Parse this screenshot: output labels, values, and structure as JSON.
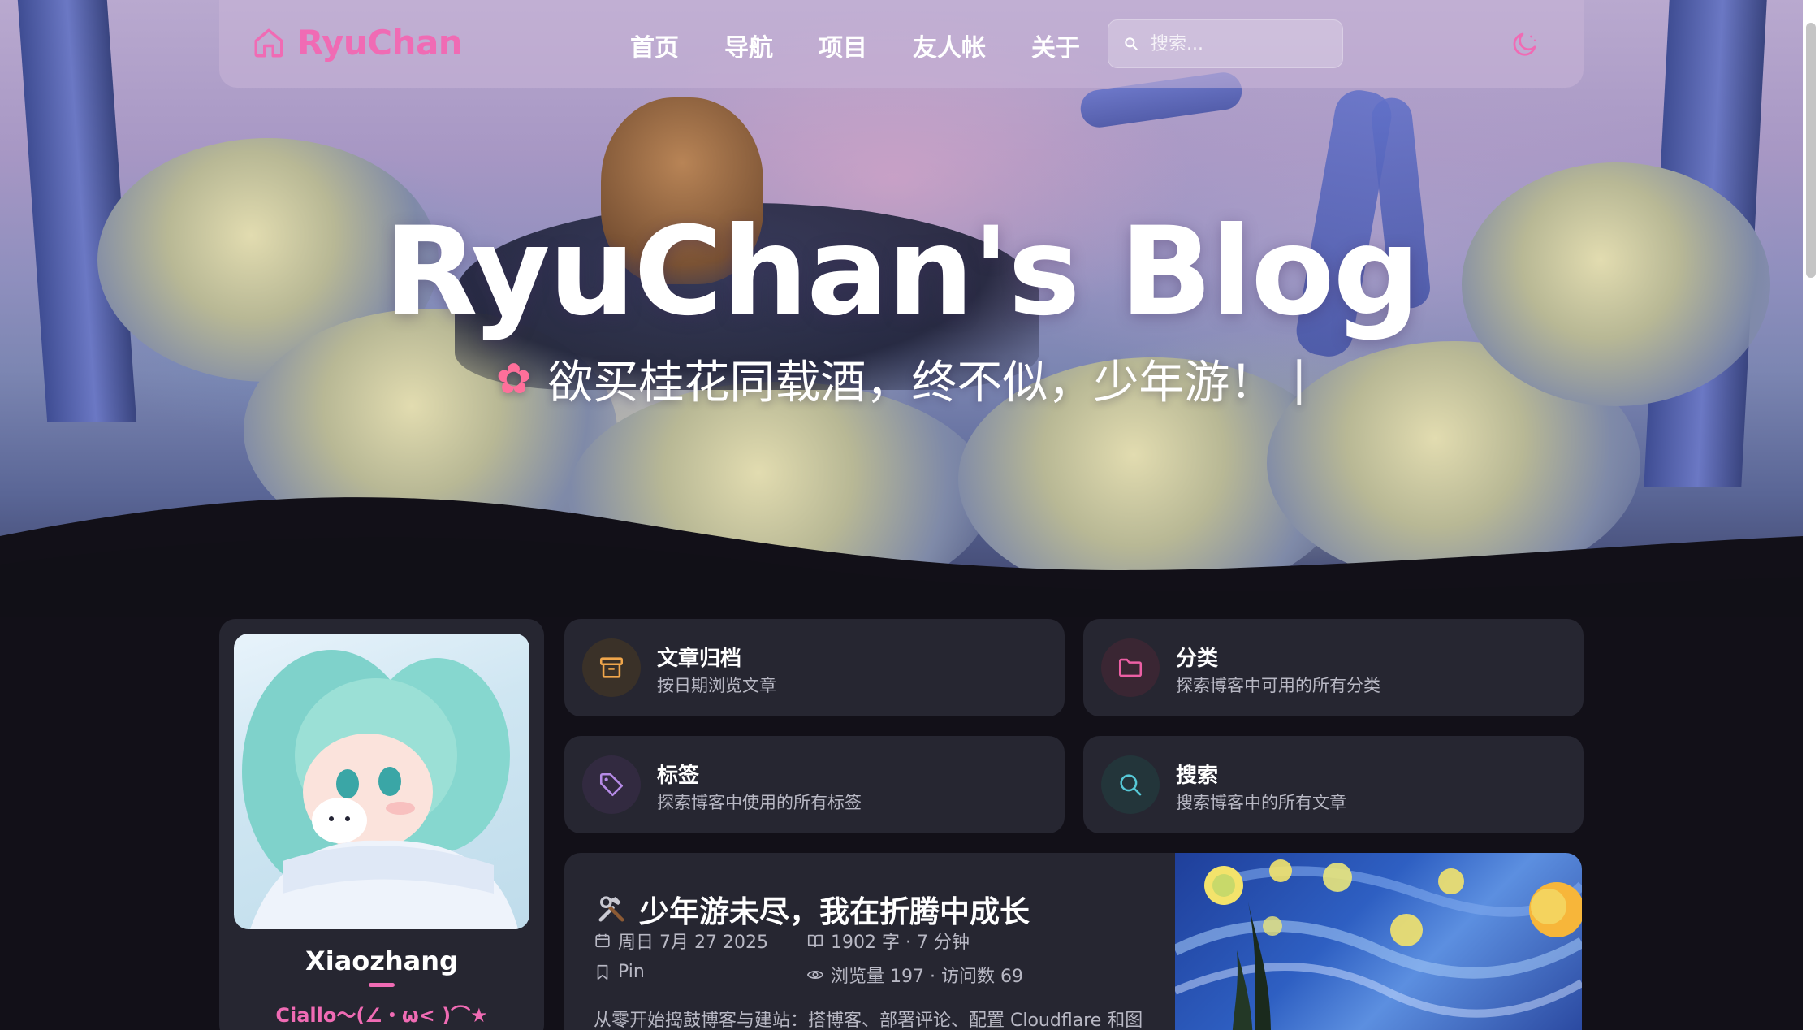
{
  "nav": {
    "brand": "RyuChan",
    "items": [
      {
        "label": "首页"
      },
      {
        "label": "导航"
      },
      {
        "label": "项目"
      },
      {
        "label": "友人帐"
      },
      {
        "label": "关于"
      }
    ],
    "search_placeholder": "搜索...",
    "brand_color": "#f06bb4"
  },
  "hero": {
    "title": "RyuChan's Blog",
    "subtitle": "欲买桂花同载酒，终不似，少年游！",
    "cursor": "|",
    "flower_icon": "cherry-blossom-icon"
  },
  "profile": {
    "name": "Xiaozhang",
    "motto": "Ciallo～(∠・ω< )⌒★"
  },
  "quick_links": [
    {
      "title": "文章归档",
      "desc": "按日期浏览文章",
      "icon": "archive-box-icon",
      "accent": "#f0a64b"
    },
    {
      "title": "分类",
      "desc": "探索博客中可用的所有分类",
      "icon": "folder-icon",
      "accent": "#ec5fa4"
    },
    {
      "title": "标签",
      "desc": "探索博客中使用的所有标签",
      "icon": "tag-icon",
      "accent": "#b58ae6"
    },
    {
      "title": "搜索",
      "desc": "搜索博客中的所有文章",
      "icon": "search-icon",
      "accent": "#56c8d6"
    }
  ],
  "post": {
    "emoji_icon": "hammer-wrench-icon",
    "title": "少年游未尽，我在折腾中成长",
    "date": "周日 7月 27 2025",
    "words": "1902 字 · 7 分钟",
    "pin": "Pin",
    "views": "浏览量 197 · 访问数 69",
    "excerpt": "从零开始捣鼓博客与建站：搭博客、部署评论、配置 Cloudflare 和图"
  }
}
